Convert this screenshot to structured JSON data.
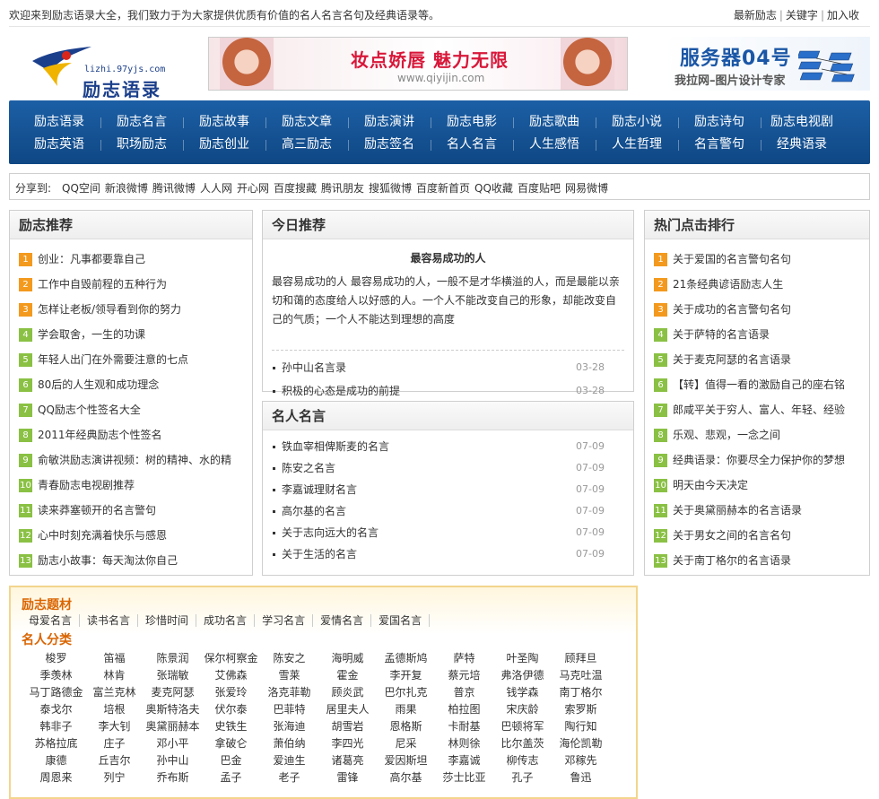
{
  "topbar": {
    "welcome": "欢迎来到励志语录大全，我们致力于为大家提供优质有价值的名人名言名句及经典语录等。",
    "links": [
      "最新励志",
      "关键字",
      "加入收"
    ]
  },
  "header": {
    "logo_domain": "lizhi.97yjs.com",
    "logo_name": "励志语录",
    "ad1_title": "妆点娇唇    魅力无限",
    "ad1_url": "www.qiyijin.com",
    "ad2_title": "服务器04号",
    "ad2_sub": "我拉网–图片设计专家"
  },
  "nav": {
    "row1": [
      "励志语录",
      "励志名言",
      "励志故事",
      "励志文章",
      "励志演讲",
      "励志电影",
      "励志歌曲",
      "励志小说",
      "励志诗句",
      "励志电视剧"
    ],
    "row2": [
      "励志英语",
      "职场励志",
      "励志创业",
      "高三励志",
      "励志签名",
      "名人名言",
      "人生感悟",
      "人生哲理",
      "名言警句",
      "经典语录"
    ]
  },
  "share": {
    "label": "分享到:",
    "links": [
      "QQ空间",
      "新浪微博",
      "腾讯微博",
      "人人网",
      "开心网",
      "百度搜藏",
      "腾讯朋友",
      "搜狐微博",
      "百度新首页",
      "QQ收藏",
      "百度贴吧",
      "网易微博"
    ]
  },
  "left_panel": {
    "title": "励志推荐",
    "items": [
      {
        "n": "1",
        "text": "创业：凡事都要靠自己"
      },
      {
        "n": "2",
        "text": "工作中自毁前程的五种行为"
      },
      {
        "n": "3",
        "text": "怎样让老板/领导看到你的努力"
      },
      {
        "n": "4",
        "text": "学会取舍，一生的功课"
      },
      {
        "n": "5",
        "text": "年轻人出门在外需要注意的七点"
      },
      {
        "n": "6",
        "text": "80后的人生观和成功理念"
      },
      {
        "n": "7",
        "text": "QQ励志个性签名大全"
      },
      {
        "n": "8",
        "text": "2011年经典励志个性签名"
      },
      {
        "n": "9",
        "text": "俞敏洪励志演讲视频：树的精神、水的精"
      },
      {
        "n": "10",
        "text": "青春励志电视剧推荐"
      },
      {
        "n": "11",
        "text": "读来莽塞顿开的名言警句"
      },
      {
        "n": "12",
        "text": "心中时刻充满着快乐与感恩"
      },
      {
        "n": "13",
        "text": "励志小故事：每天淘汰你自己"
      }
    ]
  },
  "today_panel": {
    "title": "今日推荐",
    "headline": "最容易成功的人",
    "body": "最容易成功的人 最容易成功的人，一般不是才华横溢的人，而是最能以亲切和蔼的态度给人以好感的人。一个人不能改变自己的形象，却能改变自己的气质；一个人不能达到理想的高度",
    "items": [
      {
        "text": "孙中山名言录",
        "date": "03-28"
      },
      {
        "text": "积极的心态是成功的前提",
        "date": "03-28"
      }
    ]
  },
  "famous_panel": {
    "title": "名人名言",
    "items": [
      {
        "text": "铁血宰相俾斯麦的名言",
        "date": "07-09"
      },
      {
        "text": "陈安之名言",
        "date": "07-09"
      },
      {
        "text": "李嘉诚理财名言",
        "date": "07-09"
      },
      {
        "text": "高尔基的名言",
        "date": "07-09"
      },
      {
        "text": "关于志向远大的名言",
        "date": "07-09"
      },
      {
        "text": "关于生活的名言",
        "date": "07-09"
      }
    ]
  },
  "right_panel": {
    "title": "热门点击排行",
    "items": [
      {
        "n": "1",
        "text": "关于爱国的名言警句名句"
      },
      {
        "n": "2",
        "text": "21条经典谚语励志人生"
      },
      {
        "n": "3",
        "text": "关于成功的名言警句名句"
      },
      {
        "n": "4",
        "text": "关于萨特的名言语录"
      },
      {
        "n": "5",
        "text": "关于麦克阿瑟的名言语录"
      },
      {
        "n": "6",
        "text": "【转】值得一看的激励自己的座右铭"
      },
      {
        "n": "7",
        "text": "郎咸平关于穷人、富人、年轻、经验"
      },
      {
        "n": "8",
        "text": "乐观、悲观，一念之间"
      },
      {
        "n": "9",
        "text": "经典语录：你要尽全力保护你的梦想"
      },
      {
        "n": "10",
        "text": "明天由今天决定"
      },
      {
        "n": "11",
        "text": "关于奥黛丽赫本的名言语录"
      },
      {
        "n": "12",
        "text": "关于男女之间的名言名句"
      },
      {
        "n": "13",
        "text": "关于南丁格尔的名言语录"
      }
    ]
  },
  "bottom_panel": {
    "topics_title": "励志题材",
    "topics": [
      "母爱名言",
      "读书名言",
      "珍惜时间",
      "成功名言",
      "学习名言",
      "爱情名言",
      "爱国名言"
    ],
    "people_title": "名人分类",
    "people": [
      "梭罗",
      "笛福",
      "陈景润",
      "保尔柯察金",
      "陈安之",
      "海明威",
      "孟德斯鸠",
      "萨特",
      "叶圣陶",
      "顾拜旦",
      "季羡林",
      "林肯",
      "张瑞敏",
      "艾佛森",
      "雪莱",
      "霍金",
      "李开复",
      "蔡元培",
      "弗洛伊德",
      "马克吐温",
      "马丁路德金",
      "富兰克林",
      "麦克阿瑟",
      "张爱玲",
      "洛克菲勒",
      "顾炎武",
      "巴尔扎克",
      "普京",
      "钱学森",
      "南丁格尔",
      "泰戈尔",
      "培根",
      "奥斯特洛夫",
      "伏尔泰",
      "巴菲特",
      "居里夫人",
      "雨果",
      "柏拉图",
      "宋庆龄",
      "索罗斯",
      "韩非子",
      "李大钊",
      "奥黛丽赫本",
      "史铁生",
      "张海迪",
      "胡雪岩",
      "恩格斯",
      "卡耐基",
      "巴顿将军",
      "陶行知",
      "苏格拉底",
      "庄子",
      "邓小平",
      "拿破仑",
      "萧伯纳",
      "李四光",
      "尼采",
      "林则徐",
      "比尔盖茨",
      "海伦凯勒",
      "康德",
      "丘吉尔",
      "孙中山",
      "巴金",
      "爱迪生",
      "诸葛亮",
      "爱因斯坦",
      "李嘉诚",
      "柳传志",
      "邓稼先",
      "周恩来",
      "列宁",
      "乔布斯",
      "孟子",
      "老子",
      "雷锋",
      "高尔基",
      "莎士比亚",
      "孔子",
      "鲁迅"
    ]
  },
  "colors": {
    "nav_blue": "#1c5fa5",
    "rank_top": "#f39a1e",
    "rank_rest": "#8ac144",
    "section_orange": "#d96400"
  }
}
